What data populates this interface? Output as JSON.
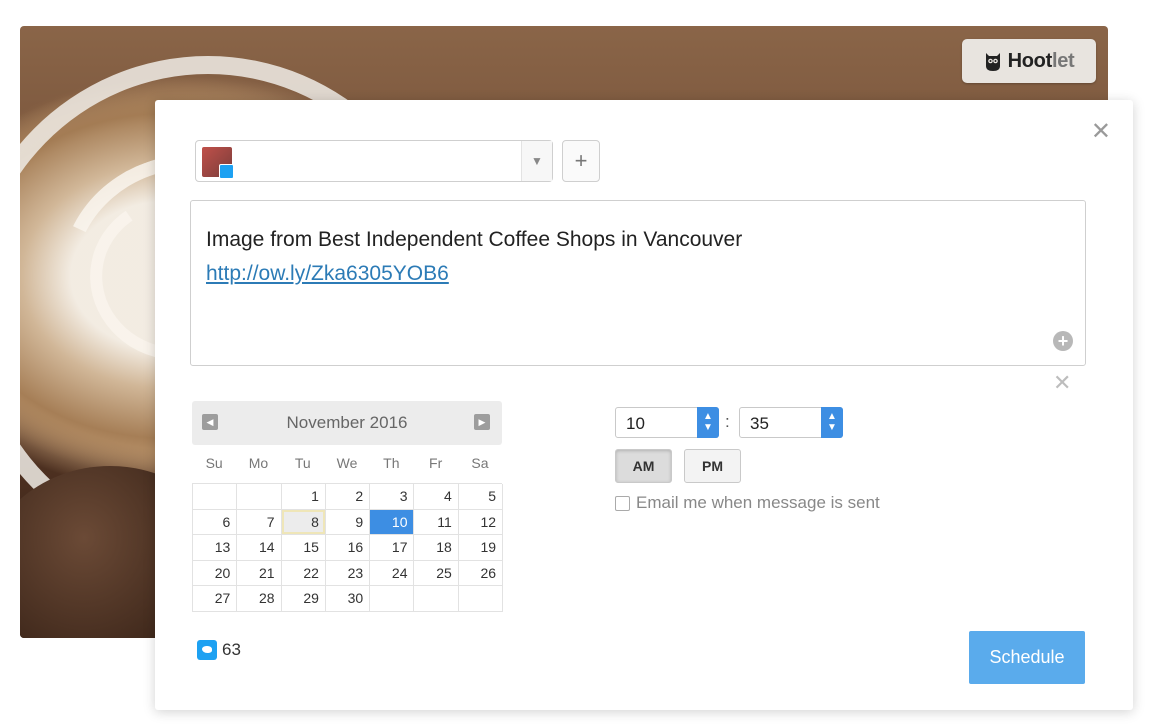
{
  "brand": {
    "name_bold": "Hoot",
    "name_light": "let",
    "icon": "owl-icon"
  },
  "composer": {
    "line1": "Image from Best Independent Coffee Shops in Vancouver",
    "link": "http://ow.ly/Zka6305YOB6"
  },
  "profile_select": {
    "add_label": "+"
  },
  "calendar": {
    "month_label": "November 2016",
    "days_of_week": [
      "Su",
      "Mo",
      "Tu",
      "We",
      "Th",
      "Fr",
      "Sa"
    ],
    "weeks": [
      [
        "",
        "",
        "1",
        "2",
        "3",
        "4",
        "5"
      ],
      [
        "6",
        "7",
        "8",
        "9",
        "10",
        "11",
        "12"
      ],
      [
        "13",
        "14",
        "15",
        "16",
        "17",
        "18",
        "19"
      ],
      [
        "20",
        "21",
        "22",
        "23",
        "24",
        "25",
        "26"
      ],
      [
        "27",
        "28",
        "29",
        "30",
        "",
        "",
        ""
      ]
    ],
    "today": "8",
    "selected": "10"
  },
  "time": {
    "hour": "10",
    "minute": "35",
    "separator": ":",
    "am_label": "AM",
    "pm_label": "PM",
    "period": "AM"
  },
  "email_option": {
    "label": "Email me when message is sent",
    "checked": false
  },
  "footer": {
    "char_count": "63",
    "schedule_label": "Schedule"
  },
  "colors": {
    "accent": "#3d8ee3",
    "schedule": "#5aabec",
    "twitter": "#1da1f2"
  }
}
